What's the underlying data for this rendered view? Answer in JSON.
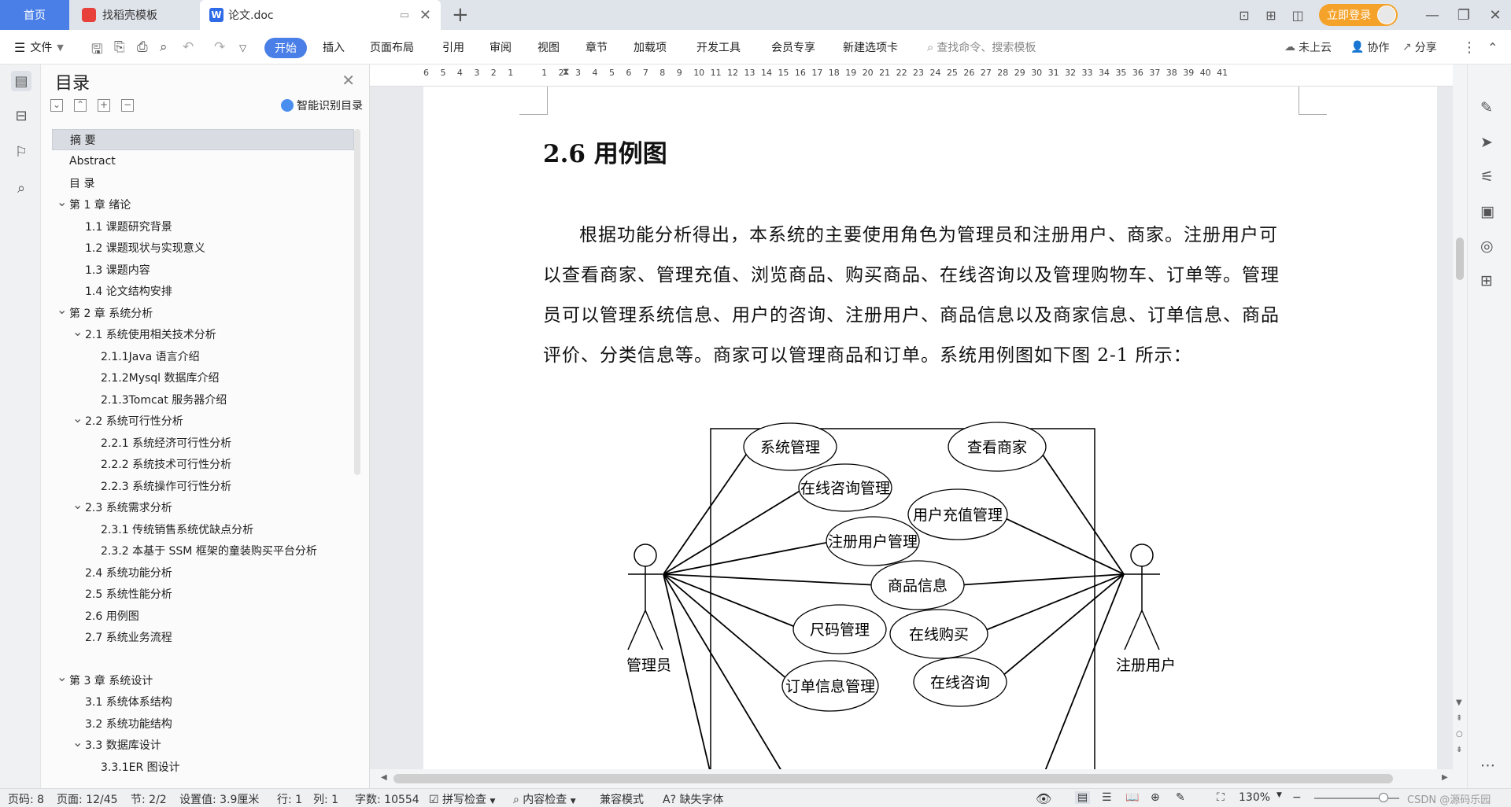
{
  "tabs": {
    "home": "首页",
    "doke": "找稻壳模板",
    "doc": "论文.doc",
    "add": "+"
  },
  "titlebar": {
    "login": "立即登录"
  },
  "ribbon": {
    "file": "文件",
    "menus": [
      "开始",
      "插入",
      "页面布局",
      "引用",
      "审阅",
      "视图",
      "章节",
      "加载项",
      "开发工具",
      "会员专享",
      "新建选项卡"
    ],
    "search_placeholder": "查找命令、搜索模板",
    "cloud": "未上云",
    "collab": "协作",
    "share": "分享"
  },
  "toc": {
    "title": "目录",
    "smart": "智能识别目录",
    "items": [
      {
        "label": "摘    要",
        "level": 0,
        "expand": false,
        "selected": true
      },
      {
        "label": "Abstract",
        "level": 0,
        "expand": false
      },
      {
        "label": "目  录",
        "level": 0,
        "expand": false
      },
      {
        "label": "第 1 章    绪论",
        "level": 0,
        "expand": true
      },
      {
        "label": "1.1 课题研究背景",
        "level": 1,
        "expand": false
      },
      {
        "label": "1.2 课题现状与实现意义",
        "level": 1,
        "expand": false
      },
      {
        "label": "1.3 课题内容",
        "level": 1,
        "expand": false
      },
      {
        "label": "1.4 论文结构安排",
        "level": 1,
        "expand": false
      },
      {
        "label": "第 2 章    系统分析",
        "level": 0,
        "expand": true
      },
      {
        "label": "2.1 系统使用相关技术分析",
        "level": 1,
        "expand": true
      },
      {
        "label": "2.1.1Java 语言介绍",
        "level": 2,
        "expand": false
      },
      {
        "label": "2.1.2Mysql 数据库介绍",
        "level": 2,
        "expand": false
      },
      {
        "label": "2.1.3Tomcat 服务器介绍",
        "level": 2,
        "expand": false
      },
      {
        "label": "2.2 系统可行性分析",
        "level": 1,
        "expand": true
      },
      {
        "label": "2.2.1 系统经济可行性分析",
        "level": 2,
        "expand": false
      },
      {
        "label": "2.2.2 系统技术可行性分析",
        "level": 2,
        "expand": false
      },
      {
        "label": "2.2.3 系统操作可行性分析",
        "level": 2,
        "expand": false
      },
      {
        "label": "2.3 系统需求分析",
        "level": 1,
        "expand": true
      },
      {
        "label": "2.3.1 传统销售系统优缺点分析",
        "level": 2,
        "expand": false
      },
      {
        "label": "2.3.2 本基于 SSM 框架的童装购买平台分析",
        "level": 2,
        "expand": false
      },
      {
        "label": "2.4 系统功能分析",
        "level": 1,
        "expand": false
      },
      {
        "label": "2.5 系统性能分析",
        "level": 1,
        "expand": false
      },
      {
        "label": "2.6 用例图",
        "level": 1,
        "expand": false
      },
      {
        "label": "2.7 系统业务流程",
        "level": 1,
        "expand": false
      },
      {
        "label": "第 3 章    系统设计",
        "level": 0,
        "expand": true,
        "gap": true
      },
      {
        "label": "3.1 系统体系结构",
        "level": 1,
        "expand": false
      },
      {
        "label": "3.2 系统功能结构",
        "level": 1,
        "expand": false
      },
      {
        "label": "3.3 数据库设计",
        "level": 1,
        "expand": true
      },
      {
        "label": "3.3.1ER 图设计",
        "level": 2,
        "expand": false
      }
    ]
  },
  "ruler": {
    "numbers": [
      "6",
      "5",
      "4",
      "3",
      "2",
      "1",
      "",
      "1",
      "2",
      "3",
      "4",
      "5",
      "6",
      "7",
      "8",
      "9",
      "10",
      "11",
      "12",
      "13",
      "14",
      "15",
      "16",
      "17",
      "18",
      "19",
      "20",
      "21",
      "22",
      "23",
      "24",
      "25",
      "26",
      "27",
      "28",
      "29",
      "30",
      "31",
      "32",
      "33",
      "34",
      "35",
      "36",
      "37",
      "38",
      "39",
      "40",
      "41"
    ]
  },
  "document": {
    "heading": "2.6 用例图",
    "paragraph": "根据功能分析得出，本系统的主要使用角色为管理员和注册用户、商家。注册用户可以查看商家、管理充值、浏览商品、购买商品、在线咨询以及管理购物车、订单等。管理员可以管理系统信息、用户的咨询、注册用户、商品信息以及商家信息、订单信息、商品评价、分类信息等。商家可以管理商品和订单。系统用例图如下图 2-1 所示：",
    "diagram": {
      "actor_left": "管理员",
      "actor_right": "注册用户",
      "usecases": [
        "系统管理",
        "查看商家",
        "在线咨询管理",
        "用户充值管理",
        "注册用户管理",
        "商品信息",
        "尺码管理",
        "在线购买",
        "订单信息管理",
        "在线咨询"
      ]
    }
  },
  "status": {
    "page_code": "页码: 8",
    "page": "页面: 12/45",
    "section": "节: 2/2",
    "setting": "设置值: 3.9厘米",
    "row": "行: 1",
    "col": "列: 1",
    "words": "字数: 10554",
    "spell": "拼写检查",
    "content": "内容检查",
    "compat": "兼容模式",
    "font": "缺失字体",
    "zoom": "130%",
    "watermark": "CSDN @源码乐园"
  }
}
